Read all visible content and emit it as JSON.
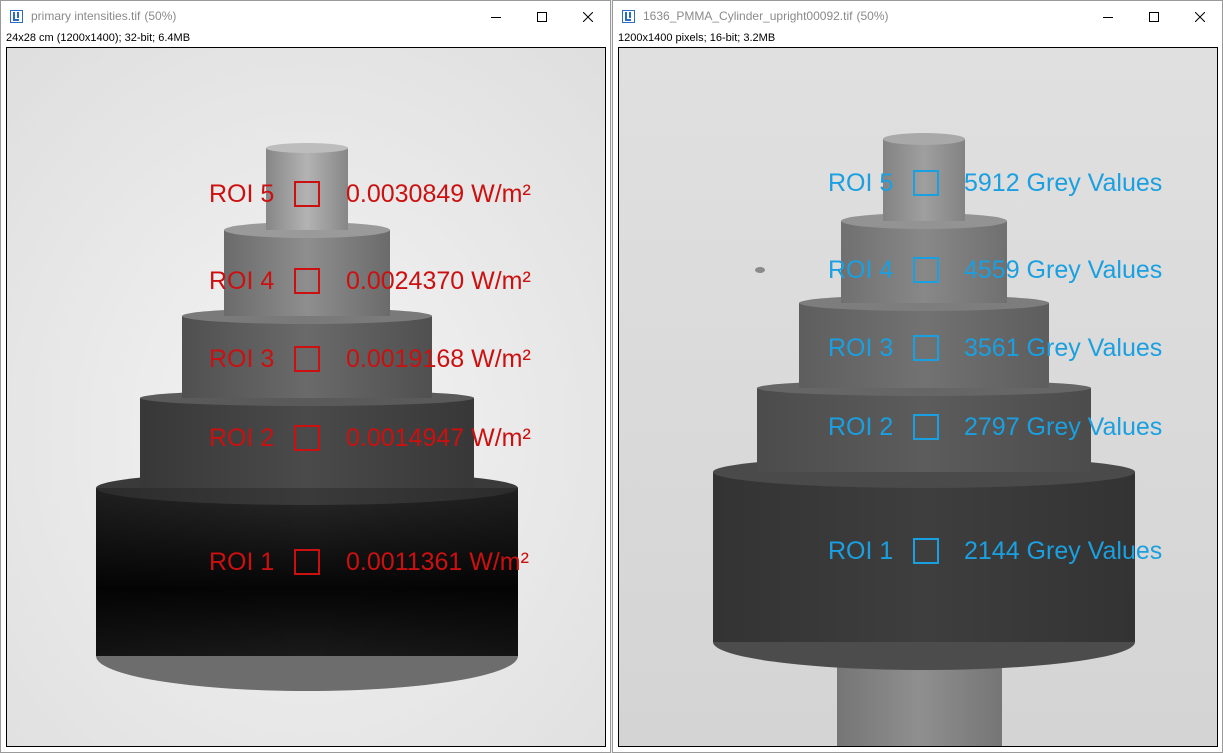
{
  "colors": {
    "roi_left": "#cc1010",
    "roi_right": "#1aa0e0",
    "title_text": "#8a8a8a"
  },
  "icons": {
    "app": "imagej-icon",
    "minimize": "minimize-icon",
    "maximize": "maximize-icon",
    "close": "close-icon"
  },
  "left": {
    "title": "primary intensities.tif",
    "zoom": "(50%)",
    "info": "24x28 cm (1200x1400); 32-bit; 6.4MB",
    "rois": [
      {
        "label": "ROI 5",
        "value": "0.0030849 W/m²"
      },
      {
        "label": "ROI 4",
        "value": "0.0024370 W/m²"
      },
      {
        "label": "ROI 3",
        "value": "0.0019168 W/m²"
      },
      {
        "label": "ROI 2",
        "value": "0.0014947 W/m²"
      },
      {
        "label": "ROI 1",
        "value": "0.0011361 W/m²"
      }
    ]
  },
  "right": {
    "title": "1636_PMMA_Cylinder_upright00092.tif",
    "zoom": "(50%)",
    "info": "1200x1400 pixels; 16-bit; 3.2MB",
    "rois": [
      {
        "label": "ROI 5",
        "value": "5912 Grey Values"
      },
      {
        "label": "ROI 4",
        "value": "4559 Grey Values"
      },
      {
        "label": "ROI 3",
        "value": "3561 Grey Values"
      },
      {
        "label": "ROI 2",
        "value": "2797 Grey Values"
      },
      {
        "label": "ROI 1",
        "value": "2144 Grey Values"
      }
    ]
  }
}
